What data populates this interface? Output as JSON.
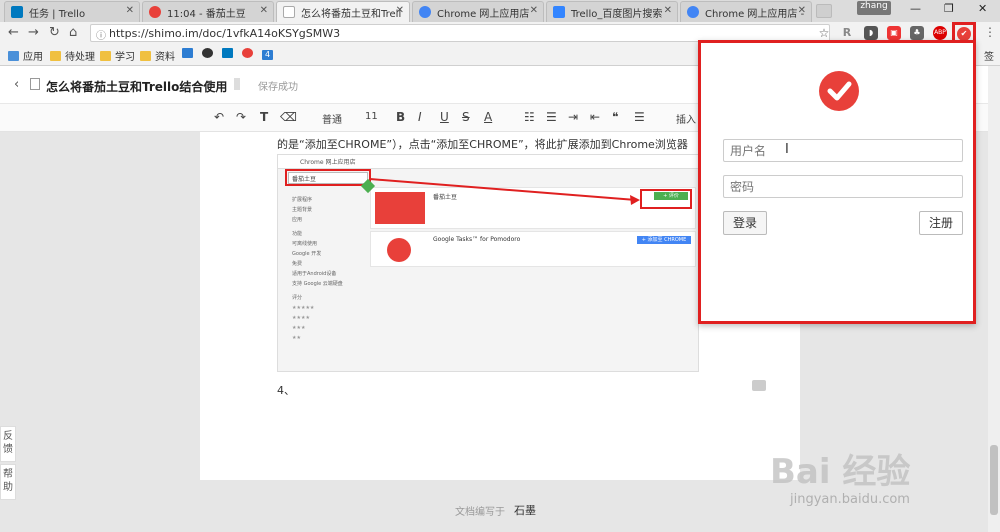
{
  "tabs": [
    {
      "title": "任务 | Trello",
      "color": "#0079bf"
    },
    {
      "title": "11:04 - 番茄土豆",
      "color": "#e8403a"
    },
    {
      "title": "怎么将番茄土豆和Trell",
      "color": "#ffffff"
    },
    {
      "title": "Chrome 网上应用店",
      "color": "#4285f4"
    },
    {
      "title": "Trello_百度图片搜索",
      "color": "#3385ff"
    },
    {
      "title": "Chrome 网上应用店 -",
      "color": "#4285f4"
    }
  ],
  "window": {
    "user": "zhang",
    "minimize": "—",
    "restore": "❐",
    "close": "✕"
  },
  "address": {
    "url": "https://shimo.im/doc/1vfkA14oKSYgSMW3"
  },
  "extensions": [
    {
      "name": "star-icon",
      "glyph": "☆",
      "color": "#555"
    },
    {
      "name": "r-extension-icon",
      "glyph": "R",
      "color": "#888"
    },
    {
      "name": "pocket-icon",
      "glyph": "◗",
      "color": "#555"
    },
    {
      "name": "red-extension-icon",
      "glyph": "▣",
      "color": "#e33"
    },
    {
      "name": "evernote-icon",
      "glyph": "♣",
      "color": "#555"
    },
    {
      "name": "adblock-icon",
      "glyph": "ABP",
      "color": "#d00"
    },
    {
      "name": "tomato-extension-icon",
      "glyph": "✔",
      "color": "#e8403a"
    }
  ],
  "bookmarks": [
    {
      "label": "应用",
      "color": "#4a90d9"
    },
    {
      "label": "待处理",
      "color": "#f0c040"
    },
    {
      "label": "学习",
      "color": "#f0c040"
    },
    {
      "label": "资料",
      "color": "#f0c040"
    },
    {
      "label": "",
      "color": "#2d7dd2"
    },
    {
      "label": "",
      "color": "#333"
    },
    {
      "label": "",
      "color": "#0079bf"
    },
    {
      "label": "",
      "color": "#e8403a"
    },
    {
      "label": "4",
      "color": "#2d7dd2"
    },
    {
      "label": "签",
      "color": "#888"
    }
  ],
  "doc": {
    "title": "怎么将番茄土豆和Trello结合使用",
    "dropdown": "▾",
    "status": "保存成功",
    "paragraph": "的是“添加至CHROME”），点击“添加至CHROME”，将此扩展添加到Chrome浏览器",
    "step": "4、",
    "footer_label": "文档编写于",
    "footer_app": "石墨"
  },
  "toolbar": {
    "undo": "↶",
    "redo": "↷",
    "format": "T",
    "eraser": "⌫",
    "style": "普通",
    "size": "11",
    "bold": "B",
    "italic": "I",
    "underline": "U",
    "strike": "S",
    "color": "A",
    "ol": "☷",
    "ul": "☰",
    "indent": "⇥",
    "outdent": "⇤",
    "quote": "❝",
    "align": "☰",
    "insert": "插入"
  },
  "embedded": {
    "store_title": "Chrome 网上应用店",
    "search": "番茄土豆",
    "item1_name": "番茄土豆",
    "item1_btn": "+ 评价",
    "item2_name": "Google Tasks™ for Pomodoro",
    "item2_btn": "+ 添加至 CHROME",
    "sidebar": [
      "扩展程序",
      "主题背景",
      "应用",
      "功能",
      "可离线使用",
      "Google 开发",
      "免费",
      "适用于Android设备",
      "支持 Google 云端硬盘",
      "评分"
    ]
  },
  "popup": {
    "username_placeholder": "用户名",
    "password_placeholder": "密码",
    "login": "登录",
    "register": "注册"
  },
  "side": {
    "feedback": "反馈",
    "help": "帮助"
  },
  "watermark": {
    "brand": "Bai 经验",
    "url": "jingyan.baidu.com"
  }
}
